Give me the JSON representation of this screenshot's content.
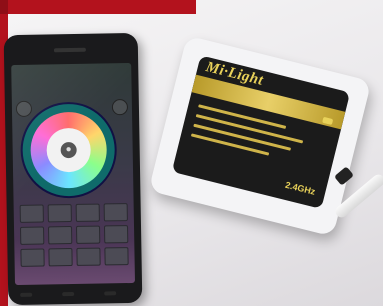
{
  "scene": {
    "device_brand": "Mi·Light",
    "device_model_badge": "2.4GHz",
    "phone_app": "color-wheel-controller"
  },
  "colors": {
    "background": "#eceaec",
    "accent_red": "#b3121d",
    "phone_body": "#1a1a1c",
    "wheel_teal": "#0f6b6a",
    "label_gold": "#e9d25a"
  }
}
